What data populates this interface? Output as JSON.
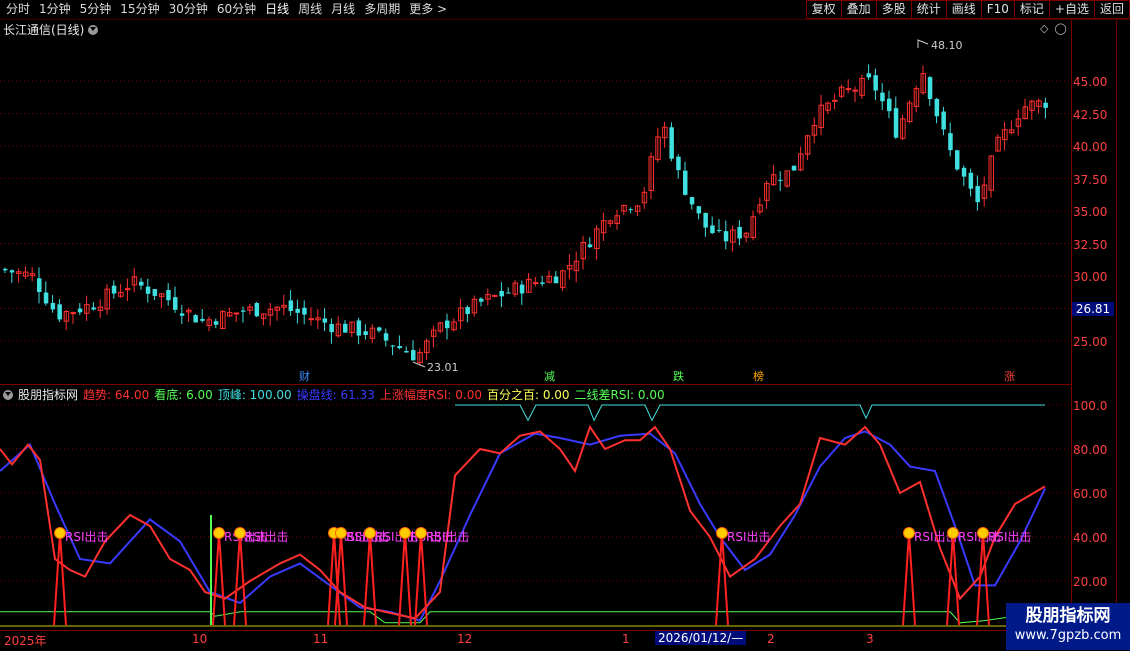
{
  "toolbar": {
    "periods": [
      "分时",
      "1分钟",
      "5分钟",
      "15分钟",
      "30分钟",
      "60分钟",
      "日线",
      "周线",
      "月线",
      "多周期",
      "更多 >"
    ],
    "active_period": "日线",
    "buttons": [
      "复权",
      "叠加",
      "多股",
      "统计",
      "画线",
      "F10",
      "标记",
      "+自选",
      "返回"
    ]
  },
  "price_panel": {
    "title": "长江通信(日线)",
    "y_ticks": [
      "45.00",
      "42.50",
      "40.00",
      "37.50",
      "35.00",
      "32.50",
      "30.00",
      "27.50",
      "25.00"
    ],
    "current_price": "26.81",
    "high_label": "48.10",
    "low_label": "23.01",
    "events": [
      {
        "text": "财",
        "color": "#3c8cff"
      },
      {
        "text": "减",
        "color": "#55ff55"
      },
      {
        "text": "跌",
        "color": "#55ff55"
      },
      {
        "text": "榜",
        "color": "#ffaa00"
      },
      {
        "text": "涨",
        "color": "#ff4040"
      }
    ]
  },
  "indicator_panel": {
    "name": "股朋指标网",
    "items": [
      {
        "label": "趋势: 64.00",
        "color": "#ff3030"
      },
      {
        "label": "看底: 6.00",
        "color": "#55ff55"
      },
      {
        "label": "顶峰: 100.00",
        "color": "#40e0e0"
      },
      {
        "label": "操盘线: 61.33",
        "color": "#3a3aff"
      },
      {
        "label": "上涨幅度RSI: 0.00",
        "color": "#ff3030"
      },
      {
        "label": "百分之百: 0.00",
        "color": "#ffff55"
      },
      {
        "label": "二线差RSI: 0.00",
        "color": "#55ff55"
      }
    ],
    "y_ticks": [
      "100.0",
      "80.00",
      "60.00",
      "40.00",
      "20.00"
    ],
    "signal_text": "RSI出击"
  },
  "date_axis": {
    "labels": [
      "2025年",
      "10",
      "11",
      "12",
      "1",
      "2",
      "3"
    ],
    "cursor": "2026/01/12/—"
  },
  "watermark": {
    "line1": "股朋指标网",
    "line2": "www.7gpzb.com"
  },
  "colors": {
    "up": "#ff3030",
    "down": "#40e0e0",
    "grid": "#7a0000",
    "axis_text": "#ff4040"
  }
}
